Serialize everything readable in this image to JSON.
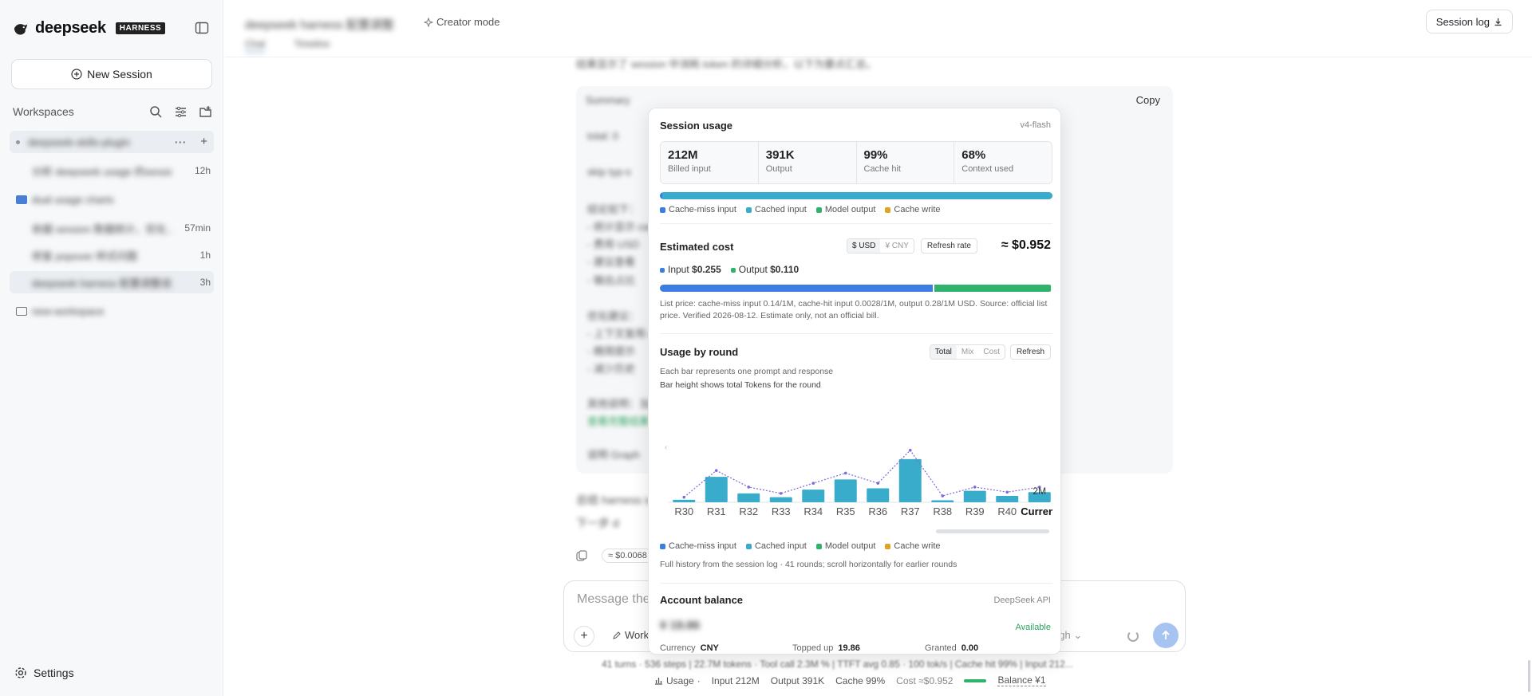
{
  "brand": {
    "name": "deepseek",
    "badge": "HARNESS"
  },
  "sidebar": {
    "new_session": "New Session",
    "workspaces_label": "Workspaces",
    "tree": [
      {
        "label": "deepseek-skills-plugin",
        "meta": "",
        "indent": 0,
        "active": true,
        "blurred": true
      },
      {
        "label": "分析 deepseek usage 的session数据",
        "meta": "12h",
        "indent": 1,
        "active": false,
        "blurred": true
      },
      {
        "label": "dual usage charts",
        "meta": "",
        "indent": 0,
        "active": false,
        "blurred": true,
        "folder": true
      },
      {
        "label": "依据 session 数据统计，优化…",
        "meta": "57min",
        "indent": 1,
        "active": false,
        "blurred": true
      },
      {
        "label": "修复 popover 样式问题",
        "meta": "1h",
        "indent": 1,
        "active": false,
        "blurred": true
      },
      {
        "label": "deepseek harness 配置调整说明",
        "meta": "3h",
        "indent": 1,
        "active": true,
        "blurred": true
      },
      {
        "label": "new-workspace",
        "meta": "",
        "indent": 0,
        "active": false,
        "blurred": true,
        "folder": true
      }
    ],
    "settings": "Settings"
  },
  "header": {
    "title": "deepseek harness 配置调整",
    "creator_mode": "Creator mode",
    "tabs": [
      "Chat",
      "Timeline"
    ],
    "session_log": "Session log"
  },
  "chat": {
    "copy": "Copy",
    "cost_chip": "≈ $0.0068",
    "lines": [
      "结果显示了 session 中消耗 token 的详细分析，以下为要点汇总。",
      "Summary",
      "total: 0",
      "skip typ-s",
      "结论如下：",
      "- 统计显示 cache 76",
      "- 费用 USD",
      "- 建议查看",
      "- 输出占比",
      "优化建议：",
      "- 上下文复用 v1 上下文缓存",
      "- 精简提示",
      "- 减少历史",
      "其他说明：当前 session 数据 前置",
      "查看完整结果",
      "说明 Graph",
      "总结 harness session",
      "下一步 d"
    ]
  },
  "composer": {
    "placeholder": "Message the agent",
    "workspace": "Work",
    "effort": "High"
  },
  "stats_line": "41 turns · 536 steps  |  22.7M tokens · Tool call 2.3M %  |  TTFT avg 0.85 · 100 tok/s  |  Cache hit 99%  |  Input 212...",
  "status_bar": {
    "usage": "Usage",
    "input": "Input 212M",
    "output": "Output 391K",
    "cache": "Cache 99%",
    "cost": "Cost ≈$0.952",
    "balance": "Balance ¥1"
  },
  "popover": {
    "session_usage": {
      "title": "Session usage",
      "model": "v4-flash",
      "metrics": [
        {
          "value": "212M",
          "label": "Billed input"
        },
        {
          "value": "391K",
          "label": "Output"
        },
        {
          "value": "99%",
          "label": "Cache hit"
        },
        {
          "value": "68%",
          "label": "Context used"
        }
      ],
      "token_split": {
        "cache_miss": 0.006,
        "cached": 0.992,
        "output": 0.002,
        "cache_write": 0
      },
      "legend": [
        "Cache-miss input",
        "Cached input",
        "Model output",
        "Cache write"
      ]
    },
    "cost": {
      "title": "Estimated cost",
      "currencies": [
        "$ USD",
        "¥ CNY"
      ],
      "selected_currency": "$ USD",
      "refresh_rate": "Refresh rate",
      "total": "≈ $0.952",
      "input_label": "Input",
      "input_value": "$0.255",
      "output_label": "Output",
      "output_value": "$0.110",
      "input_share": 0.699,
      "note": "List price: cache-miss input 0.14/1M, cache-hit input 0.0028/1M, output 0.28/1M USD. Source: official list price.  Verified 2026-08-12. Estimate only, not an official bill."
    },
    "rounds": {
      "title": "Usage by round",
      "modes": [
        "Total",
        "Mix",
        "Cost"
      ],
      "selected_mode": "Total",
      "refresh": "Refresh",
      "desc1": "Each bar represents one prompt and response",
      "desc2": "Bar height shows total Tokens for the round",
      "legend": [
        "Cache-miss input",
        "Cached input",
        "Model output",
        "Cache write"
      ],
      "footnote": "Full history from the session log · 41 rounds; scroll horizontally for earlier rounds"
    },
    "balance": {
      "title": "Account balance",
      "provider": "DeepSeek API",
      "amount": "¥ 19.86",
      "status": "Available",
      "currency_label": "Currency",
      "currency": "CNY",
      "topped_label": "Topped up",
      "topped": "19.86",
      "granted_label": "Granted",
      "granted": "0.00"
    }
  },
  "chart_data": {
    "type": "bar",
    "categories": [
      "R30",
      "R31",
      "R32",
      "R33",
      "R34",
      "R35",
      "R36",
      "R37",
      "R38",
      "R39",
      "R40",
      "Current"
    ],
    "series": [
      {
        "values": [
          0.1,
          1.0,
          0.35,
          0.2,
          0.5,
          0.9,
          0.55,
          1.7,
          0.08,
          0.45,
          0.25,
          0.4
        ]
      }
    ],
    "line_values": [
      0.2,
      1.25,
      0.6,
      0.35,
      0.75,
      1.15,
      0.75,
      2.05,
      0.25,
      0.6,
      0.4,
      0.6
    ],
    "ymax_label": "2M",
    "ylim": [
      0,
      2.2
    ],
    "colors": {
      "bar": "#3aaccb",
      "line": "#7b6ad8"
    }
  },
  "colors": {
    "cache_miss": "#3b7de0",
    "cached": "#3aaccb",
    "output": "#2fb36a",
    "cache_write": "#e0a227",
    "available": "#2fa35f"
  }
}
